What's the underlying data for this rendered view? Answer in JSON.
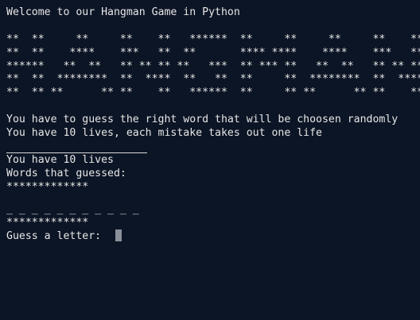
{
  "welcome": "Welcome to our Hangman Game in Python",
  "banner": [
    "**  **     **     **    **   ******  **     **     **     **    **",
    "**  **    ****    ***   **  **       **** ****    ****    ***   **",
    "******   **  **   ** ** ** **   ***  ** *** **   **  **   ** ** **",
    "**  **  ********  **  ****  **   **  **     **  ********  **  ****",
    "**  ** **      ** **    **   ******  **     ** **      ** **    **"
  ],
  "instructions": [
    "You have to guess the right word that will be choosen randomly",
    "You have 10 lives, each mistake takes out one life"
  ],
  "status": {
    "lives_line": "You have 10 lives",
    "words_label": "Words that guessed:",
    "stars_top": "*************",
    "blanks": "_ _ _ _ _ _ _ _ _ _ _",
    "stars_bottom": "*************"
  },
  "prompt": {
    "label": "Guess a letter:  "
  }
}
